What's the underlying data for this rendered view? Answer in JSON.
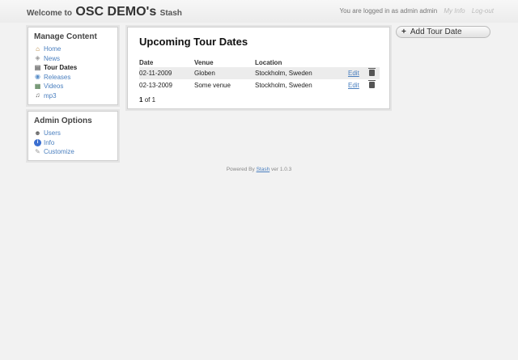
{
  "header": {
    "welcome_prefix": "Welcome to",
    "site_name": "OSC DEMO's",
    "suffix": "Stash",
    "login_text": "You are logged in as admin admin",
    "my_info": "My Info",
    "logout": "Log-out"
  },
  "sidebar": {
    "manage_title": "Manage Content",
    "manage_items": [
      {
        "label": "Home",
        "icon": "home-icon"
      },
      {
        "label": "News",
        "icon": "tag-icon"
      },
      {
        "label": "Tour Dates",
        "icon": "calendar-icon"
      },
      {
        "label": "Releases",
        "icon": "disc-icon"
      },
      {
        "label": "Videos",
        "icon": "film-icon"
      },
      {
        "label": "mp3",
        "icon": "music-note-icon"
      }
    ],
    "admin_title": "Admin Options",
    "admin_items": [
      {
        "label": "Users",
        "icon": "user-icon"
      },
      {
        "label": "Info",
        "icon": "info-icon"
      },
      {
        "label": "Customize",
        "icon": "customize-icon"
      }
    ]
  },
  "main": {
    "title": "Upcoming Tour Dates",
    "columns": [
      "Date",
      "Venue",
      "Location"
    ],
    "rows": [
      {
        "date": "02-11-2009",
        "venue": "Globen",
        "location": "Stockholm, Sweden",
        "edit": "Edit"
      },
      {
        "date": "02-13-2009",
        "venue": "Some venue",
        "location": "Stockholm, Sweden",
        "edit": "Edit"
      }
    ],
    "pager_current": "1",
    "pager_rest": "of 1"
  },
  "add_button": {
    "label": "Add Tour Date"
  },
  "footer": {
    "prefix": "Powered By",
    "link": "Stash",
    "suffix": "ver 1.0.3"
  },
  "colors": {
    "link": "#4a7fbf",
    "background": "#f2f2f2"
  }
}
